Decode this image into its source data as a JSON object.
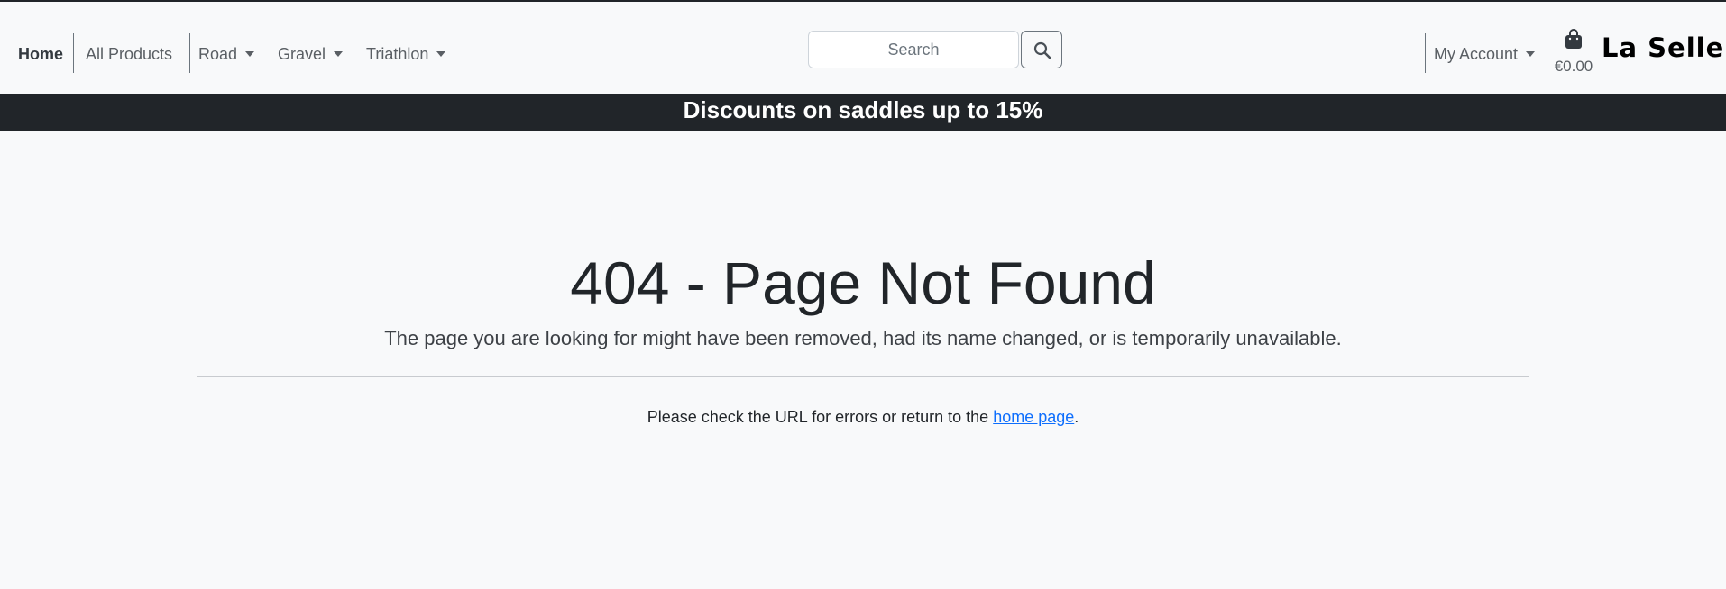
{
  "nav": {
    "home": "Home",
    "all_products": "All Products",
    "road": "Road",
    "gravel": "Gravel",
    "triathlon": "Triathlon",
    "my_account": "My Account"
  },
  "search": {
    "placeholder": "Search",
    "button_icon": "search-icon"
  },
  "cart": {
    "icon": "shopping-bag-icon",
    "total": "€0.00"
  },
  "brand": "La Selle",
  "banner": "Discounts on saddles up to 15%",
  "error": {
    "title": "404 - Page Not Found",
    "lead": "The page you are looking for might have been removed, had its name changed, or is temporarily unavailable.",
    "help_prefix": "Please check the URL for errors or return to the ",
    "help_link": "home page",
    "help_suffix": "."
  },
  "colors": {
    "banner_bg": "#212529",
    "link": "#0d6efd",
    "page_bg": "#f8f9fa"
  }
}
